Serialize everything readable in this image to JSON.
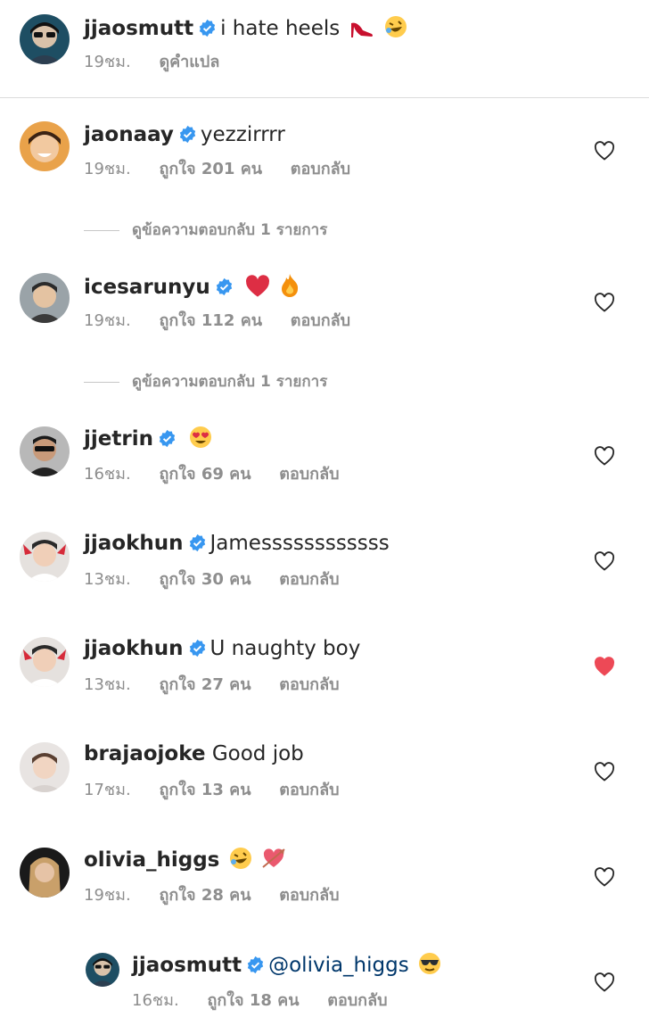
{
  "colors": {
    "text": "#262626",
    "secondary": "#8e8e8e",
    "verified": "#3897f0",
    "liked": "#ed4956",
    "mention": "#00376b"
  },
  "caption": {
    "username": "jjaosmutt",
    "text": "i hate heels",
    "time": "19ชม.",
    "translate": "ดูคำแปล",
    "emojis": [
      "high-heel",
      "rofl"
    ]
  },
  "comments": [
    {
      "username": "jaonaay",
      "verified": true,
      "text": "yezzirrrr",
      "time": "19ชม.",
      "likes": "ถูกใจ 201 คน",
      "reply": "ตอบกลับ",
      "liked": false,
      "view_replies": "ดูข้อความตอบกลับ 1 รายการ"
    },
    {
      "username": "icesarunyu",
      "verified": true,
      "text": "",
      "emojis": [
        "red-heart",
        "fire"
      ],
      "time": "19ชม.",
      "likes": "ถูกใจ 112 คน",
      "reply": "ตอบกลับ",
      "liked": false,
      "view_replies": "ดูข้อความตอบกลับ 1 รายการ"
    },
    {
      "username": "jjetrin",
      "verified": true,
      "text": "",
      "emojis": [
        "heart-eyes"
      ],
      "time": "16ชม.",
      "likes": "ถูกใจ 69 คน",
      "reply": "ตอบกลับ",
      "liked": false
    },
    {
      "username": "jjaokhun",
      "verified": true,
      "text": "Jamessssssssssss",
      "time": "13ชม.",
      "likes": "ถูกใจ 30 คน",
      "reply": "ตอบกลับ",
      "liked": false
    },
    {
      "username": "jjaokhun",
      "verified": true,
      "text": "U naughty boy",
      "time": "13ชม.",
      "likes": "ถูกใจ 27 คน",
      "reply": "ตอบกลับ",
      "liked": true
    },
    {
      "username": "brajaojoke",
      "verified": false,
      "text": "Good job",
      "time": "17ชม.",
      "likes": "ถูกใจ 13 คน",
      "reply": "ตอบกลับ",
      "liked": false
    },
    {
      "username": "olivia_higgs",
      "verified": false,
      "text": "",
      "emojis": [
        "rofl",
        "heart-arrow"
      ],
      "time": "19ชม.",
      "likes": "ถูกใจ 28 คน",
      "reply": "ตอบกลับ",
      "liked": false
    },
    {
      "username": "jjaosmutt",
      "verified": true,
      "is_reply": true,
      "mention": "@olivia_higgs",
      "emojis": [
        "sunglasses"
      ],
      "time": "16ชม.",
      "likes": "ถูกใจ 18 คน",
      "reply": "ตอบกลับ",
      "liked": false
    }
  ]
}
